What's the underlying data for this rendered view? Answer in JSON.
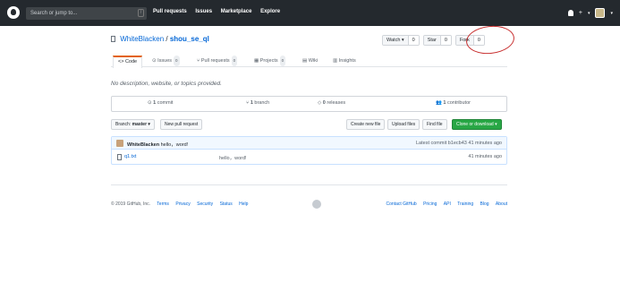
{
  "header": {
    "search_placeholder": "Search or jump to...",
    "search_shortcut": "/",
    "nav": [
      "Pull requests",
      "Issues",
      "Marketplace",
      "Explore"
    ],
    "plus_label": "+",
    "caret": "▾"
  },
  "repo": {
    "owner": "WhiteBlacken",
    "separator": " / ",
    "name": "shou_se_ql",
    "watch_label": "Watch ▾",
    "watch_count": "0",
    "star_label": "Star",
    "star_count": "0",
    "fork_label": "Fork",
    "fork_count": "0"
  },
  "tabs": [
    {
      "label": "Code"
    },
    {
      "label": "Issues",
      "count": "0"
    },
    {
      "label": "Pull requests",
      "count": "0"
    },
    {
      "label": "Projects",
      "count": "0"
    },
    {
      "label": "Wiki"
    },
    {
      "label": "Insights"
    }
  ],
  "description": "No description, website, or topics provided.",
  "summary": {
    "commits": "1",
    "commits_label": " commit",
    "branches": "1",
    "branches_label": " branch",
    "releases": "0",
    "releases_label": " releases",
    "contributors": "1",
    "contributors_label": " contributor"
  },
  "toolbar": {
    "branch_prefix": "Branch:",
    "branch": "master ▾",
    "new_pr": "New pull request",
    "create_file": "Create new file",
    "upload_files": "Upload files",
    "find_file": "Find file",
    "clone": "Clone or download ▾"
  },
  "latest_commit": {
    "author": "WhiteBlacken",
    "message": " hello，word!",
    "prefix": "Latest commit ",
    "sha": "b1ecb43",
    "time": " 41 minutes ago"
  },
  "files": [
    {
      "name": "q1.txt",
      "message": "hello，word!",
      "age": "41 minutes ago"
    }
  ],
  "footer": {
    "copyright": "© 2019 GitHub, Inc.",
    "left_links": [
      "Terms",
      "Privacy",
      "Security",
      "Status",
      "Help"
    ],
    "right_links": [
      "Contact GitHub",
      "Pricing",
      "API",
      "Training",
      "Blog",
      "About"
    ]
  },
  "colors": {
    "header_bg": "#24292e",
    "link": "#0366d6",
    "clone_button": "#28a745",
    "annotation_circle": "#c83030"
  }
}
